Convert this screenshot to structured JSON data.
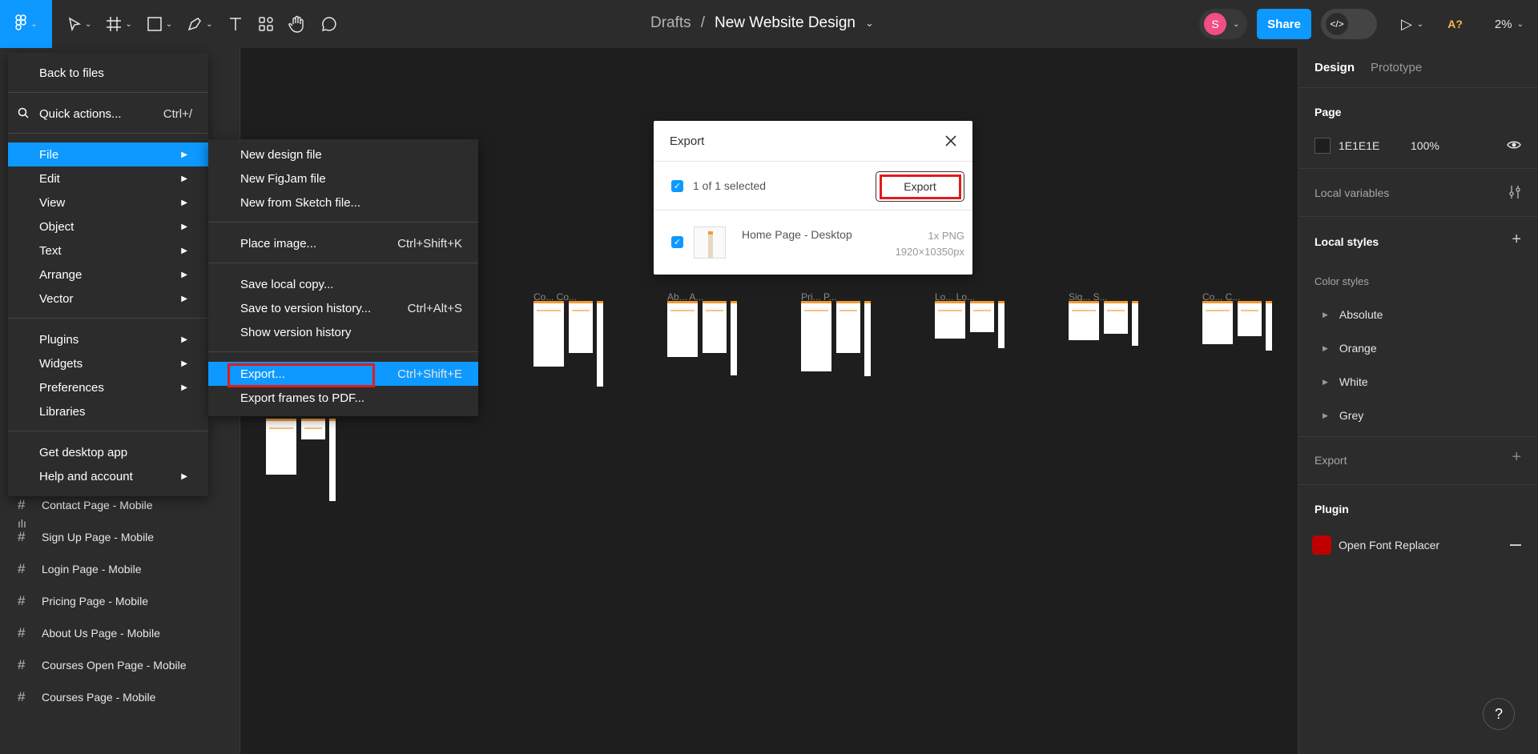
{
  "toolbar": {
    "breadcrumb_parent": "Drafts",
    "breadcrumb_sep": "/",
    "file_name": "New Website Design",
    "share_label": "Share",
    "avatar_initial": "S",
    "font_warning": "A?",
    "zoom": "2%"
  },
  "main_menu": {
    "back": "Back to files",
    "quick_actions": "Quick actions...",
    "quick_actions_shortcut": "Ctrl+/",
    "items": [
      "File",
      "Edit",
      "View",
      "Object",
      "Text",
      "Arrange",
      "Vector"
    ],
    "items2": [
      "Plugins",
      "Widgets",
      "Preferences",
      "Libraries"
    ],
    "desktop": "Get desktop app",
    "help": "Help and account"
  },
  "file_menu": {
    "new_design": "New design file",
    "new_figjam": "New FigJam file",
    "new_sketch": "New from Sketch file...",
    "place_image": "Place image...",
    "place_image_sc": "Ctrl+Shift+K",
    "save_local": "Save local copy...",
    "save_version": "Save to version history...",
    "save_version_sc": "Ctrl+Alt+S",
    "show_version": "Show version history",
    "export": "Export...",
    "export_sc": "Ctrl+Shift+E",
    "export_pdf": "Export frames to PDF..."
  },
  "export_dialog": {
    "title": "Export",
    "selected": "1 of 1 selected",
    "button": "Export",
    "item_name": "Home Page - Desktop",
    "item_scale": "1x PNG",
    "item_size": "1920×10350px"
  },
  "layers": [
    "Contact Page - Mobile",
    "Sign Up Page - Mobile",
    "Login Page - Mobile",
    "Pricing Page - Mobile",
    "About Us Page - Mobile",
    "Courses Open Page - Mobile",
    "Courses Page - Mobile"
  ],
  "canvas_frames": [
    "Co...  Co...",
    "Ab...  A...",
    "Pri...  P...",
    "Lo...  Lo...",
    "Sig...  S...",
    "Co...  C..."
  ],
  "right_panel": {
    "tab_design": "Design",
    "tab_prototype": "Prototype",
    "page_heading": "Page",
    "page_color": "1E1E1E",
    "page_opacity": "100%",
    "local_variables": "Local variables",
    "local_styles": "Local styles",
    "color_styles": "Color styles",
    "styles": [
      "Absolute",
      "Orange",
      "White",
      "Grey"
    ],
    "export": "Export",
    "plugin": "Plugin",
    "plugin_name": "Open Font Replacer"
  },
  "colors": {
    "accent": "#0d99ff",
    "highlight": "#e21b1b",
    "canvas": "#1e1e1e"
  }
}
